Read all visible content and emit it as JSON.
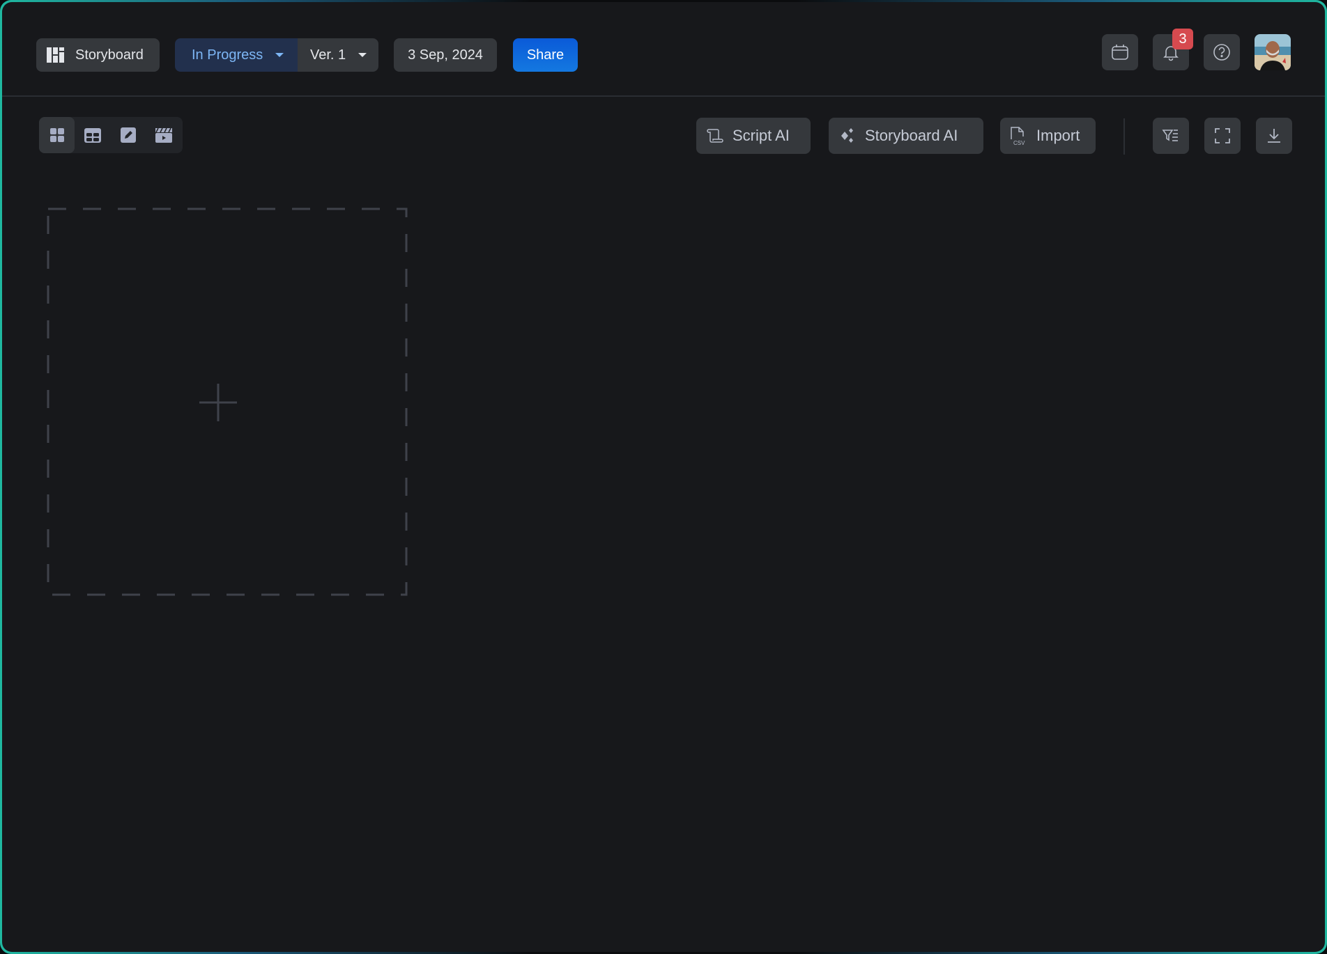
{
  "header": {
    "project_label": "Storyboard",
    "status": {
      "label": "In Progress",
      "color": "#7db6f5"
    },
    "version": {
      "label": "Ver. 1"
    },
    "date": "3 Sep, 2024",
    "share_label": "Share",
    "notification_count": "3",
    "icons": [
      "storyboard-logo-icon",
      "calendar-icon",
      "bell-icon",
      "help-icon"
    ],
    "avatar_alt": "User avatar"
  },
  "toolbar": {
    "views": [
      {
        "name": "grid-view",
        "icon": "grid-icon",
        "active": true
      },
      {
        "name": "table-view",
        "icon": "table-icon",
        "active": false
      },
      {
        "name": "edit-view",
        "icon": "pencil-icon",
        "active": false
      },
      {
        "name": "scene-view",
        "icon": "clapperboard-icon",
        "active": false
      }
    ],
    "script_ai_label": "Script AI",
    "storyboard_ai_label": "Storyboard AI",
    "import_label": "Import",
    "import_icon_text": "CSV",
    "actions": [
      "filter-icon",
      "fullscreen-icon",
      "download-icon"
    ]
  },
  "canvas": {
    "add_frame_hint": "add-frame"
  },
  "colors": {
    "background": "#17181b",
    "surface": "#35383c",
    "accent": "#1478e0",
    "badge": "#d64a4f"
  }
}
